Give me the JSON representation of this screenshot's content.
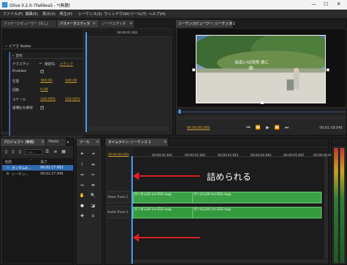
{
  "window": {
    "title": "Olive 0.2.0-7fa69ea5 - *(無題)",
    "minimize": "—",
    "maximize": "☐",
    "close": "✕"
  },
  "menu": [
    "ファイル(F)",
    "編集(E)",
    "表示(V)",
    "再生(P)",
    "シーケンス(S)",
    "ウィンドウ(W)",
    "ツール(T)",
    "ヘルプ(H)"
  ],
  "top_left_tabs": [
    "フッテージビューワー (なし)",
    "パラメータエディタ",
    "ノードエディタ"
  ],
  "param_ruler": "00:00:01.001",
  "param": {
    "video_header": "ビデオ Nodes",
    "transform": "変形",
    "texture_label": "テクスチャ",
    "texture_source_label": "接続先:",
    "texture_source_link": "メディア",
    "enabled_label": "Enabled",
    "position_label": "位置",
    "position_x": "360.00",
    "position_y": "240.00",
    "rotation_label": "回転",
    "rotation_value": "0.00",
    "scale_label": "スケール",
    "scale_x": "100.00%",
    "scale_y": "100.00%",
    "keep_aspect_label": "縦横比を維持"
  },
  "seq_viewer": {
    "tab": "シーケンスビューワー: シーケンス 1",
    "video_caption": "出会いは突然 君に",
    "current_time": "00:00:00.000",
    "duration": "00:01:18.043"
  },
  "project": {
    "tabs": [
      "プロジェクト (無題)",
      "Histor"
    ],
    "search_placeholder": "ﾌｨﾙﾀｰ...",
    "col_name": "名前",
    "col_length": "長さ",
    "rows": [
      {
        "name": "ガンダム0...",
        "length": "00:01:17.952"
      },
      {
        "name": "シーケン...",
        "length": "00:01:17.945"
      }
    ]
  },
  "tools": {
    "tab": "ツール"
  },
  "timeline": {
    "tab": "タイムライン: シーケンス 1",
    "current_time": "00:00:00.000",
    "ruler": [
      "00:00:01.001",
      "00:00:02.002",
      "00:00:03.003",
      "00:00:04.004",
      "00:00:05.005",
      "00:00:06.006"
    ],
    "video_track": "Video Track 1",
    "audio_track": "Audio Track 1",
    "clip_a": "ガンダム00 1st ED2.mpg",
    "clip_b": "ガンダム00 1st ED2.mpg",
    "annotation": "詰められる"
  },
  "colors": {
    "arrow": "#e02020",
    "clip": "#3ca046",
    "playhead": "#4aa3ff",
    "link": "#d8a530"
  }
}
